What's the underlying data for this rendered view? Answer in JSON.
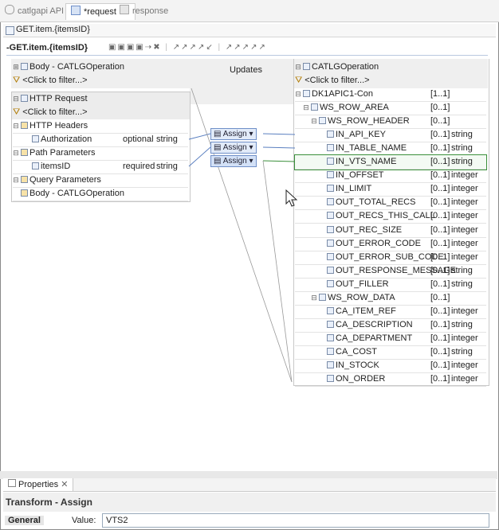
{
  "tabs": [
    {
      "label": "catlgapi API",
      "active": false
    },
    {
      "label": "*request",
      "active": true
    },
    {
      "label": "response",
      "active": false
    }
  ],
  "breadcrumb": "GET.item.{itemsID}",
  "editor_title": "-GET.item.{itemsID}",
  "filter_placeholder": "<Click to filter...>",
  "updates_label": "Updates",
  "left_top": {
    "header": "Body - CATLGOperation"
  },
  "left_panel": {
    "header": "HTTP Request",
    "rows": [
      {
        "label": "HTTP Headers",
        "level": 0,
        "note": "",
        "type": ""
      },
      {
        "label": "Authorization",
        "level": 1,
        "note": "optional",
        "type": "string"
      },
      {
        "label": "Path Parameters",
        "level": 0,
        "note": "",
        "type": ""
      },
      {
        "label": "itemsID",
        "level": 1,
        "note": "required",
        "type": "string"
      },
      {
        "label": "Query Parameters",
        "level": 0,
        "note": "",
        "type": ""
      },
      {
        "label": "Body - CATLGOperation",
        "level": 0,
        "note": "",
        "type": ""
      }
    ]
  },
  "assign_labels": [
    "Assign",
    "Assign",
    "Assign"
  ],
  "right_panel": {
    "header": "CATLGOperation",
    "rows": [
      {
        "label": "DK1APIC1-Con",
        "card": "[1..1]",
        "type": ""
      },
      {
        "label": "WS_ROW_AREA",
        "card": "[0..1]",
        "type": ""
      },
      {
        "label": "WS_ROW_HEADER",
        "card": "[0..1]",
        "type": ""
      },
      {
        "label": "IN_API_KEY",
        "card": "[0..1]",
        "type": "string"
      },
      {
        "label": "IN_TABLE_NAME",
        "card": "[0..1]",
        "type": "string"
      },
      {
        "label": "IN_VTS_NAME",
        "card": "[0..1]",
        "type": "string"
      },
      {
        "label": "IN_OFFSET",
        "card": "[0..1]",
        "type": "integer"
      },
      {
        "label": "IN_LIMIT",
        "card": "[0..1]",
        "type": "integer"
      },
      {
        "label": "OUT_TOTAL_RECS",
        "card": "[0..1]",
        "type": "integer"
      },
      {
        "label": "OUT_RECS_THIS_CALL",
        "card": "[0..1]",
        "type": "integer"
      },
      {
        "label": "OUT_REC_SIZE",
        "card": "[0..1]",
        "type": "integer"
      },
      {
        "label": "OUT_ERROR_CODE",
        "card": "[0..1]",
        "type": "integer"
      },
      {
        "label": "OUT_ERROR_SUB_CODE",
        "card": "[0..1]",
        "type": "integer"
      },
      {
        "label": "OUT_RESPONSE_MESSAGE",
        "card": "[0..1]",
        "type": "string"
      },
      {
        "label": "OUT_FILLER",
        "card": "[0..1]",
        "type": "string"
      },
      {
        "label": "WS_ROW_DATA",
        "card": "[0..1]",
        "type": ""
      },
      {
        "label": "CA_ITEM_REF",
        "card": "[0..1]",
        "type": "integer"
      },
      {
        "label": "CA_DESCRIPTION",
        "card": "[0..1]",
        "type": "string"
      },
      {
        "label": "CA_DEPARTMENT",
        "card": "[0..1]",
        "type": "integer"
      },
      {
        "label": "CA_COST",
        "card": "[0..1]",
        "type": "string"
      },
      {
        "label": "IN_STOCK",
        "card": "[0..1]",
        "type": "integer"
      },
      {
        "label": "ON_ORDER",
        "card": "[0..1]",
        "type": "integer"
      }
    ]
  },
  "properties": {
    "tab_label": "Properties",
    "title": "Transform - Assign",
    "section": "General",
    "value_label": "Value:",
    "value": "VTS2"
  },
  "colors": {
    "accent": "#6f8fc8",
    "selected_row_border": "#3a8f3a",
    "header_bg": "#ececec"
  }
}
